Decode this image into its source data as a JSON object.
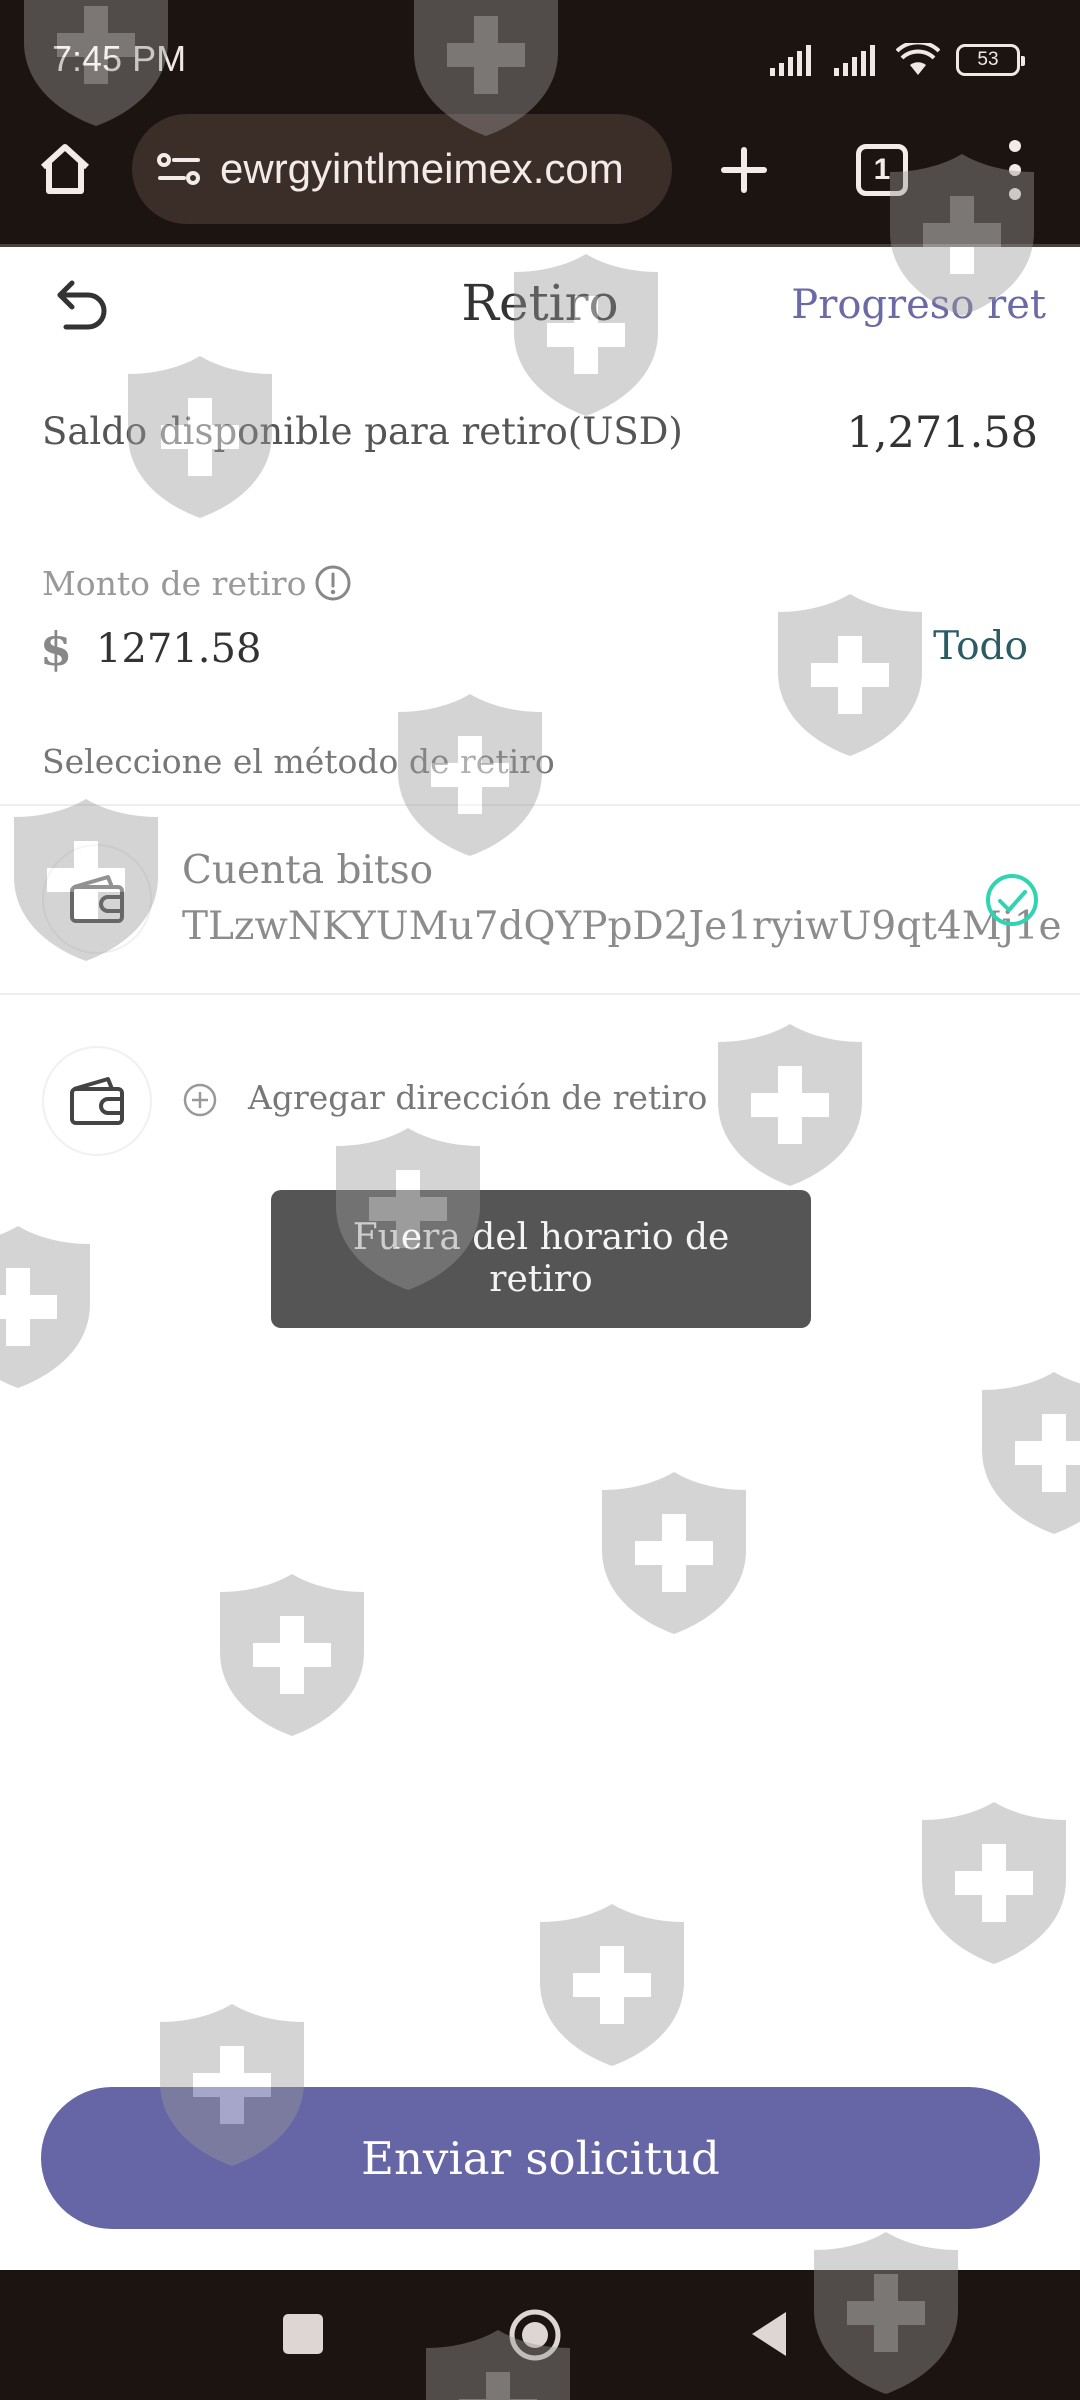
{
  "status_bar": {
    "time": "7:45 PM",
    "battery": "53"
  },
  "browser": {
    "url": "ewrgyintlmeimex.com",
    "tab_count": "1"
  },
  "header": {
    "title": "Retiro",
    "progress_link": "Progreso ret"
  },
  "balance": {
    "label": "Saldo disponible para retiro(USD)",
    "value": "1,271.58"
  },
  "amount": {
    "label": "Monto de retiro",
    "currency": "$",
    "value": "1271.58",
    "all_label": "Todo"
  },
  "method": {
    "section_label": "Seleccione el método de retiro",
    "selected": {
      "name": "Cuenta bitso",
      "address": "TLzwNKYUMu7dQYPpD2Je1ryiwU9qt4Mj1e"
    },
    "add_label": "Agregar dirección de retiro"
  },
  "toast": {
    "message": "Fuera del horario de retiro"
  },
  "submit": {
    "label": "Enviar solicitud"
  },
  "colors": {
    "chrome_bg": "#1c1411",
    "accent": "#6666a6",
    "check": "#2fd4b0"
  },
  "icons": [
    "home-icon",
    "site-settings-icon",
    "new-tab-icon",
    "tab-switcher-icon",
    "more-menu-icon",
    "back-arrow-icon",
    "info-icon",
    "wallet-icon",
    "check-circle-icon",
    "plus-circle-icon",
    "shield-watermark-icon"
  ]
}
